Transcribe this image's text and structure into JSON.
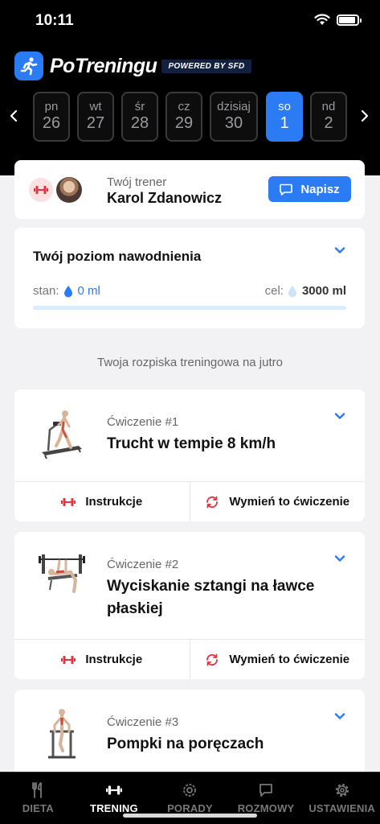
{
  "status_bar": {
    "time": "10:11"
  },
  "brand": {
    "name": "PoTreningu",
    "powered": "POWERED BY SFD"
  },
  "days": [
    {
      "name": "pn",
      "date": "26",
      "active": false
    },
    {
      "name": "wt",
      "date": "27",
      "active": false
    },
    {
      "name": "śr",
      "date": "28",
      "active": false
    },
    {
      "name": "cz",
      "date": "29",
      "active": false
    },
    {
      "name": "dzisiaj",
      "date": "30",
      "active": false
    },
    {
      "name": "so",
      "date": "1",
      "active": true
    },
    {
      "name": "nd",
      "date": "2",
      "active": false
    }
  ],
  "trainer": {
    "label": "Twój trener",
    "name": "Karol Zdanowicz",
    "write_label": "Napisz"
  },
  "hydration": {
    "title": "Twój poziom nawodnienia",
    "state_label": "stan:",
    "state_value": "0 ml",
    "goal_label": "cel:",
    "goal_value": "3000 ml",
    "progress": 0
  },
  "section_title": "Twoja rozpiska treningowa na jutro",
  "exercises": [
    {
      "number": "Ćwiczenie #1",
      "title": "Trucht w tempie 8 km/h",
      "instructions_label": "Instrukcje",
      "swap_label": "Wymień to ćwiczenie"
    },
    {
      "number": "Ćwiczenie #2",
      "title": "Wyciskanie sztangi na ławce płaskiej",
      "instructions_label": "Instrukcje",
      "swap_label": "Wymień to ćwiczenie"
    },
    {
      "number": "Ćwiczenie #3",
      "title": "Pompki na poręczach"
    }
  ],
  "tabs": [
    {
      "label": "DIETA",
      "icon": "fork-knife-icon",
      "active": false
    },
    {
      "label": "TRENING",
      "icon": "dumbbell-icon",
      "active": true
    },
    {
      "label": "PORADY",
      "icon": "gear-badge-icon",
      "active": false
    },
    {
      "label": "ROZMOWY",
      "icon": "chat-icon",
      "active": false
    },
    {
      "label": "USTAWIENIA",
      "icon": "gear-icon",
      "active": false
    }
  ],
  "colors": {
    "accent": "#2a7bf4",
    "danger": "#e4333c",
    "background": "#f2f2f4",
    "header": "#000000"
  }
}
